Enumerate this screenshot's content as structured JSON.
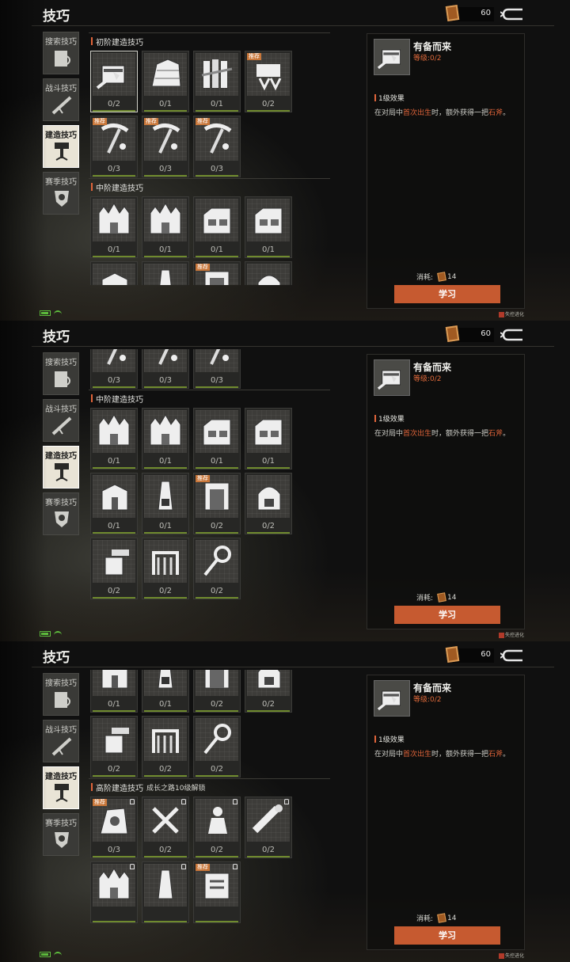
{
  "header": {
    "title": "技巧",
    "currency": "60"
  },
  "tabs": [
    {
      "label": "搜索技巧",
      "icon": "search-skill-icon",
      "active": false
    },
    {
      "label": "战斗技巧",
      "icon": "rifle-icon",
      "active": false
    },
    {
      "label": "建造技巧",
      "icon": "hammer-icon",
      "active": true
    },
    {
      "label": "赛季技巧",
      "icon": "season-badge-icon",
      "active": false
    }
  ],
  "detail": {
    "name": "有备而来",
    "level": "等级:0/2",
    "effect_header": "1级效果",
    "desc_a": "在对局中",
    "desc_hl1": "首次出生",
    "desc_b": "时，额外获得一把",
    "desc_hl2": "石斧",
    "desc_c": "。",
    "cost_label": "消耗:",
    "cost_value": "14",
    "learn_label": "学习"
  },
  "logo_text": "失控进化",
  "colors": {
    "accent": "#e0643a",
    "button": "#c65a30",
    "progress": "#6f8a2e",
    "tag": "#c9773a"
  },
  "panels": [
    {
      "items": [
        {
          "t": "h",
          "text": "初阶建造技巧"
        },
        {
          "t": "c",
          "p": "0/2",
          "icon": "chest-axe-icon",
          "sel": true
        },
        {
          "t": "c",
          "p": "0/1",
          "icon": "wall-icon"
        },
        {
          "t": "c",
          "p": "0/1",
          "icon": "wood-planks-icon"
        },
        {
          "t": "c",
          "p": "0/2",
          "icon": "repair-icon",
          "tag": "推荐"
        },
        {
          "t": "c",
          "p": "0/3",
          "icon": "pickaxe-icon",
          "tag": "推荐"
        },
        {
          "t": "c",
          "p": "0/3",
          "icon": "pickaxe-icon",
          "tag": "推荐"
        },
        {
          "t": "c",
          "p": "0/3",
          "icon": "pickaxe-icon",
          "tag": "推荐"
        },
        {
          "t": "h",
          "text": "中阶建造技巧"
        },
        {
          "t": "c",
          "p": "0/1",
          "icon": "fortress-icon"
        },
        {
          "t": "c",
          "p": "0/1",
          "icon": "fortress-icon"
        },
        {
          "t": "c",
          "p": "0/1",
          "icon": "house-icon"
        },
        {
          "t": "c",
          "p": "0/1",
          "icon": "house-icon"
        },
        {
          "t": "c",
          "p": "0/1",
          "icon": "box-icon"
        },
        {
          "t": "c",
          "p": "0/1",
          "icon": "tower-lock-icon"
        },
        {
          "t": "c",
          "p": "0/2",
          "icon": "door-icon",
          "tag": "推荐"
        },
        {
          "t": "c",
          "p": "0/2",
          "icon": "furnace-icon"
        }
      ]
    },
    {
      "items": [
        {
          "t": "c",
          "p": "0/3",
          "icon": "pickaxe-icon"
        },
        {
          "t": "c",
          "p": "0/3",
          "icon": "pickaxe-icon"
        },
        {
          "t": "c",
          "p": "0/3",
          "icon": "pickaxe-icon"
        },
        {
          "t": "h",
          "text": "中阶建造技巧"
        },
        {
          "t": "c",
          "p": "0/1",
          "icon": "fortress-icon"
        },
        {
          "t": "c",
          "p": "0/1",
          "icon": "fortress-icon"
        },
        {
          "t": "c",
          "p": "0/1",
          "icon": "house-icon"
        },
        {
          "t": "c",
          "p": "0/1",
          "icon": "house-icon"
        },
        {
          "t": "c",
          "p": "0/1",
          "icon": "box-icon"
        },
        {
          "t": "c",
          "p": "0/1",
          "icon": "tower-lock-icon"
        },
        {
          "t": "c",
          "p": "0/2",
          "icon": "door-icon",
          "tag": "推荐"
        },
        {
          "t": "c",
          "p": "0/2",
          "icon": "furnace-icon"
        },
        {
          "t": "c",
          "p": "0/2",
          "icon": "turret-icon"
        },
        {
          "t": "c",
          "p": "0/2",
          "icon": "gate-icon"
        },
        {
          "t": "c",
          "p": "0/2",
          "icon": "key-icon"
        }
      ]
    },
    {
      "items": [
        {
          "t": "c",
          "p": "0/1",
          "icon": "box-icon"
        },
        {
          "t": "c",
          "p": "0/1",
          "icon": "tower-lock-icon"
        },
        {
          "t": "c",
          "p": "0/2",
          "icon": "door-icon"
        },
        {
          "t": "c",
          "p": "0/2",
          "icon": "furnace-icon"
        },
        {
          "t": "c",
          "p": "0/2",
          "icon": "turret-icon"
        },
        {
          "t": "c",
          "p": "0/2",
          "icon": "gate-icon"
        },
        {
          "t": "c",
          "p": "0/2",
          "icon": "key-icon"
        },
        {
          "t": "h",
          "text": "高阶建造技巧",
          "sub": "成长之路10级解锁"
        },
        {
          "t": "c",
          "p": "0/3",
          "icon": "machine-icon",
          "tag": "推荐",
          "lock": true
        },
        {
          "t": "c",
          "p": "0/2",
          "icon": "tools-icon",
          "lock": true
        },
        {
          "t": "c",
          "p": "0/2",
          "icon": "figure-icon",
          "lock": true
        },
        {
          "t": "c",
          "p": "0/2",
          "icon": "log-icon",
          "lock": true
        },
        {
          "t": "c",
          "p": "",
          "icon": "fortress-icon",
          "lock": true
        },
        {
          "t": "c",
          "p": "",
          "icon": "tower-icon",
          "lock": true
        },
        {
          "t": "c",
          "p": "",
          "icon": "slot-icon",
          "tag": "推荐",
          "lock": true
        }
      ]
    }
  ]
}
